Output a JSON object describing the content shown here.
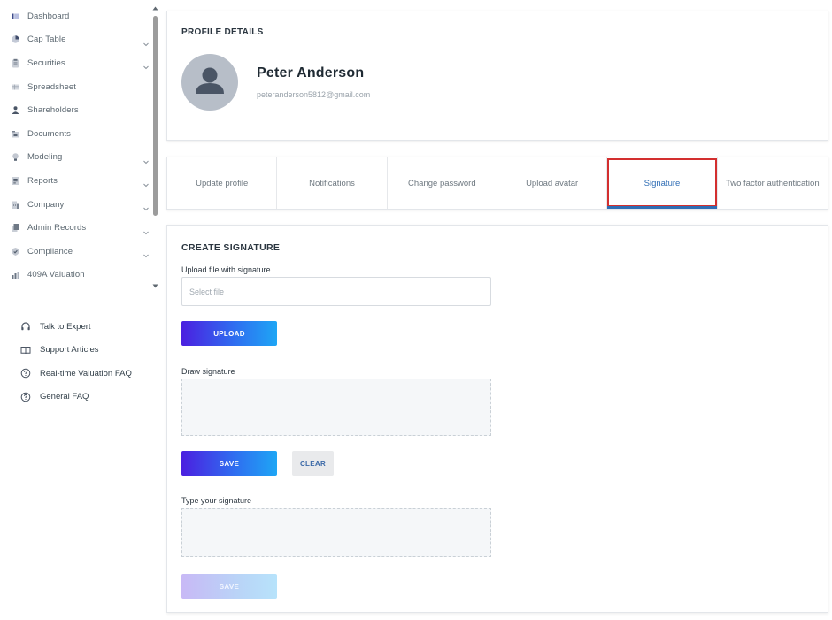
{
  "sidebar": {
    "items": [
      {
        "label": "Dashboard",
        "icon": "dashboard-icon",
        "has_chevron": false
      },
      {
        "label": "Cap Table",
        "icon": "pie-chart-icon",
        "has_chevron": true
      },
      {
        "label": "Securities",
        "icon": "clipboard-icon",
        "has_chevron": true
      },
      {
        "label": "Spreadsheet",
        "icon": "spreadsheet-icon",
        "has_chevron": false
      },
      {
        "label": "Shareholders",
        "icon": "user-icon",
        "has_chevron": false
      },
      {
        "label": "Documents",
        "icon": "folder-icon",
        "has_chevron": false
      },
      {
        "label": "Modeling",
        "icon": "lightbulb-icon",
        "has_chevron": true
      },
      {
        "label": "Reports",
        "icon": "report-icon",
        "has_chevron": true
      },
      {
        "label": "Company",
        "icon": "building-icon",
        "has_chevron": true
      },
      {
        "label": "Admin Records",
        "icon": "records-icon",
        "has_chevron": true
      },
      {
        "label": "Compliance",
        "icon": "shield-icon",
        "has_chevron": true
      },
      {
        "label": "409A Valuation",
        "icon": "valuation-chart-icon",
        "has_chevron": false
      }
    ],
    "help_items": [
      {
        "label": "Talk to Expert",
        "icon": "headphones-icon"
      },
      {
        "label": "Support Articles",
        "icon": "book-icon"
      },
      {
        "label": "Real-time Valuation FAQ",
        "icon": "question-circle-icon"
      },
      {
        "label": "General FAQ",
        "icon": "question-circle-icon"
      }
    ]
  },
  "profile": {
    "section_title": "PROFILE DETAILS",
    "name": "Peter Anderson",
    "email": "peteranderson5812@gmail.com"
  },
  "tabs": [
    {
      "label": "Update profile",
      "active": false
    },
    {
      "label": "Notifications",
      "active": false
    },
    {
      "label": "Change password",
      "active": false
    },
    {
      "label": "Upload avatar",
      "active": false
    },
    {
      "label": "Signature",
      "active": true
    },
    {
      "label": "Two factor authentication",
      "active": false
    }
  ],
  "signature": {
    "section_title": "CREATE SIGNATURE",
    "upload_label": "Upload file with signature",
    "file_placeholder": "Select file",
    "upload_button": "UPLOAD",
    "draw_label": "Draw signature",
    "save_button": "SAVE",
    "clear_button": "CLEAR",
    "type_label": "Type your signature",
    "type_save_button": "SAVE"
  },
  "colors": {
    "accent_blue": "#2f6db5",
    "highlight_red": "#d32f2f",
    "button_gradient_start": "#4b1fe0",
    "button_gradient_end": "#1ea6f5"
  }
}
